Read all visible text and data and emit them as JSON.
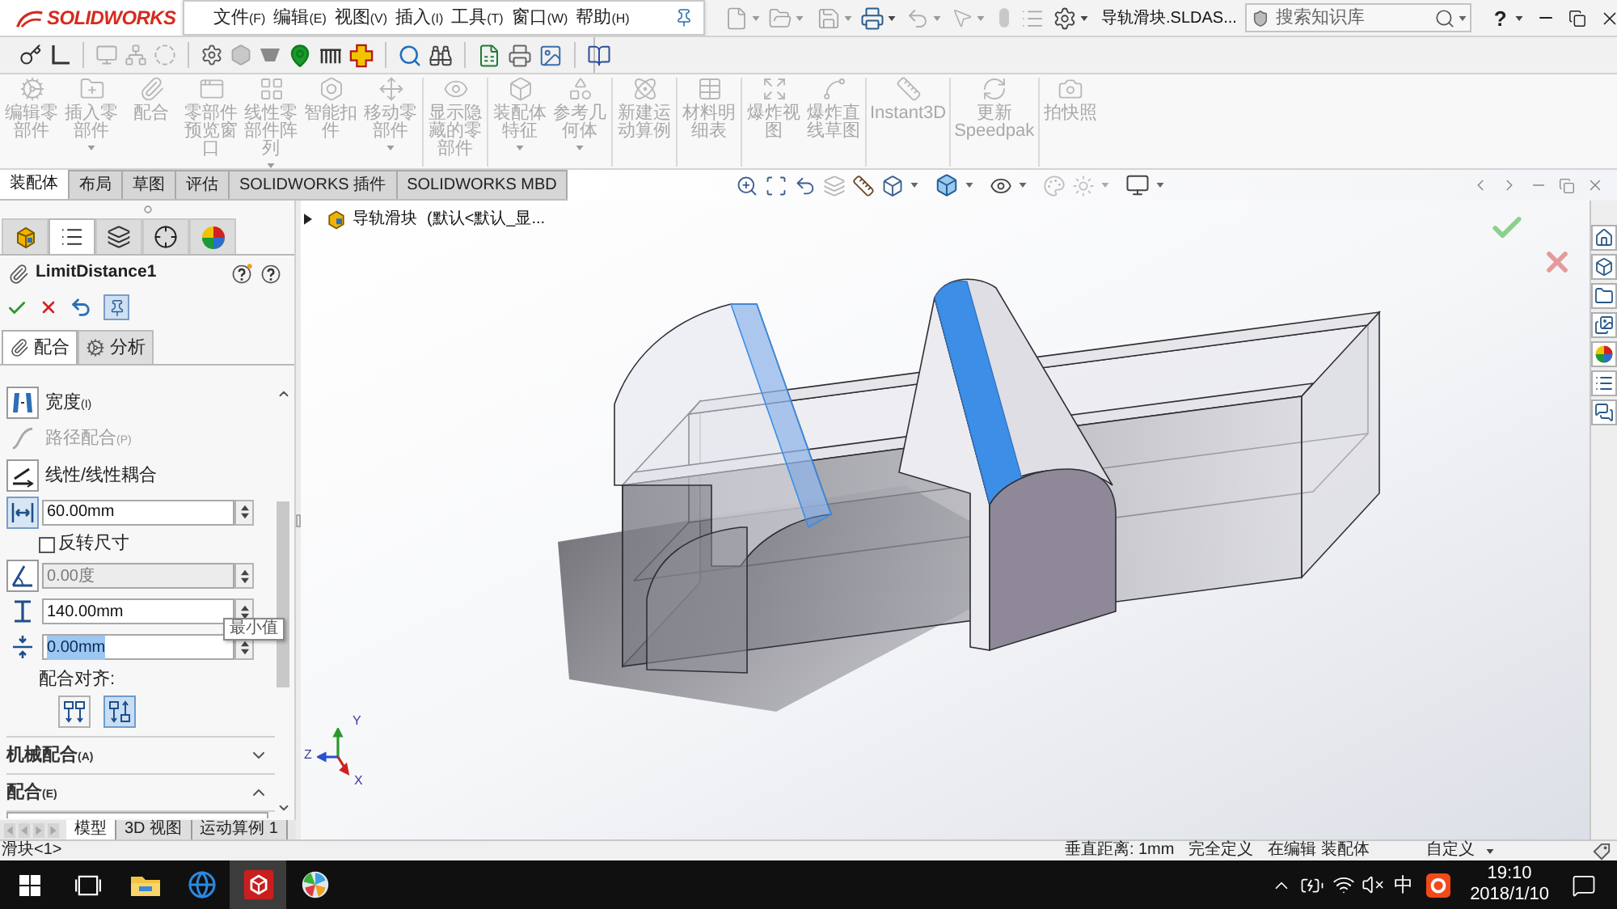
{
  "app": {
    "logo": "SOLIDWORKS",
    "menus": [
      {
        "label": "文件",
        "hotkey": "(F)"
      },
      {
        "label": "编辑",
        "hotkey": "(E)"
      },
      {
        "label": "视图",
        "hotkey": "(V)"
      },
      {
        "label": "插入",
        "hotkey": "(I)"
      },
      {
        "label": "工具",
        "hotkey": "(T)"
      },
      {
        "label": "窗口",
        "hotkey": "(W)"
      },
      {
        "label": "帮助",
        "hotkey": "(H)"
      }
    ],
    "document_title": "导轨滑块.SLDAS...",
    "search": {
      "placeholder": "搜索知识库"
    },
    "help": "?"
  },
  "command_manager": [
    {
      "items": [
        {
          "label": "编辑零部件",
          "disabled": true,
          "dropdown": false
        },
        {
          "label": "插入零部件",
          "disabled": true,
          "dropdown": true
        },
        {
          "label": "配合",
          "disabled": true,
          "dropdown": false
        },
        {
          "label": "零部件预览窗口",
          "disabled": true,
          "dropdown": false
        },
        {
          "label": "线性零部件阵列",
          "disabled": true,
          "dropdown": true
        },
        {
          "label": "智能扣件",
          "disabled": true,
          "dropdown": false
        },
        {
          "label": "移动零部件",
          "disabled": true,
          "dropdown": true
        }
      ]
    },
    {
      "items": [
        {
          "label": "显示隐藏的零部件",
          "disabled": true,
          "dropdown": false
        }
      ]
    },
    {
      "items": [
        {
          "label": "装配体特征",
          "disabled": true,
          "dropdown": true
        },
        {
          "label": "参考几何体",
          "disabled": true,
          "dropdown": true
        }
      ]
    },
    {
      "items": [
        {
          "label": "新建运动算例",
          "disabled": true,
          "dropdown": false
        }
      ]
    },
    {
      "items": [
        {
          "label": "材料明细表",
          "disabled": true,
          "dropdown": false
        }
      ]
    },
    {
      "items": [
        {
          "label": "爆炸视图",
          "disabled": true,
          "dropdown": false
        },
        {
          "label": "爆炸直线草图",
          "disabled": true,
          "dropdown": false
        }
      ]
    },
    {
      "items": [
        {
          "label": "Instant3D",
          "disabled": true,
          "dropdown": false
        }
      ]
    },
    {
      "items": [
        {
          "label": "更新 Speedpak",
          "disabled": true,
          "dropdown": false
        }
      ]
    },
    {
      "items": [
        {
          "label": "拍快照",
          "disabled": true,
          "dropdown": false
        }
      ]
    }
  ],
  "command_tabs": [
    {
      "label": "装配体",
      "selected": true
    },
    {
      "label": "布局",
      "selected": false
    },
    {
      "label": "草图",
      "selected": false
    },
    {
      "label": "评估",
      "selected": false
    },
    {
      "label": "SOLIDWORKS 插件",
      "selected": false
    },
    {
      "label": "SOLIDWORKS MBD",
      "selected": false
    }
  ],
  "property_manager": {
    "manager_tabs": [
      {
        "selected": false
      },
      {
        "selected": true
      },
      {
        "selected": false
      },
      {
        "selected": false
      },
      {
        "selected": false
      }
    ],
    "title": "LimitDistance1",
    "mate_tabs": [
      {
        "label": "配合",
        "selected": true
      },
      {
        "label": "分析",
        "selected": false
      }
    ],
    "rows": [
      {
        "kind": "width",
        "label": "宽度",
        "hotkey": "(I)",
        "disabled": false
      },
      {
        "kind": "path",
        "label": "路径配合",
        "hotkey": "(P)",
        "disabled": true
      },
      {
        "kind": "linear",
        "label": "线性/线性耦合",
        "disabled": false
      },
      {
        "kind": "distance",
        "value": "60.00mm",
        "disabled": false,
        "selected": false
      },
      {
        "kind": "checkbox",
        "label": "反转尺寸",
        "checked": false
      },
      {
        "kind": "angle",
        "value": "0.00度",
        "disabled": true,
        "selected": false
      },
      {
        "kind": "maximum",
        "value": "140.00mm",
        "disabled": false,
        "selected": false,
        "tooltip": "最小值"
      },
      {
        "kind": "minimum",
        "value": "0.00mm",
        "disabled": false,
        "selected": true
      },
      {
        "kind": "label",
        "label": "配合对齐:"
      },
      {
        "kind": "alignment",
        "options": [
          {
            "selected": false
          },
          {
            "selected": true
          }
        ]
      }
    ],
    "sections": [
      {
        "label": "机械配合",
        "hotkey": "(A)",
        "expanded": false
      },
      {
        "label": "配合",
        "hotkey": "(E)",
        "expanded": true
      }
    ]
  },
  "graphics": {
    "tree_item": {
      "name": "导轨滑块",
      "config": "(默认<默认_显..."
    },
    "triad": {
      "y": "Y",
      "z": "Z",
      "x": "X"
    }
  },
  "bottom_tabs": [
    {
      "label": "模型",
      "selected": true
    },
    {
      "label": "3D 视图",
      "selected": false
    },
    {
      "label": "运动算例 1",
      "selected": false
    }
  ],
  "status_bar": {
    "selection": "滑块<1>",
    "items": [
      "垂直距离: 1mm",
      "完全定义",
      "在编辑 装配体",
      "自定义"
    ]
  },
  "taskbar": {
    "apps": [
      {
        "kind": "explorer",
        "active": false
      },
      {
        "kind": "browser",
        "active": false
      },
      {
        "kind": "cad",
        "active": true
      },
      {
        "kind": "pinwheel",
        "active": false
      }
    ],
    "ime": "中",
    "time": "19:10",
    "date": "2018/1/10"
  }
}
